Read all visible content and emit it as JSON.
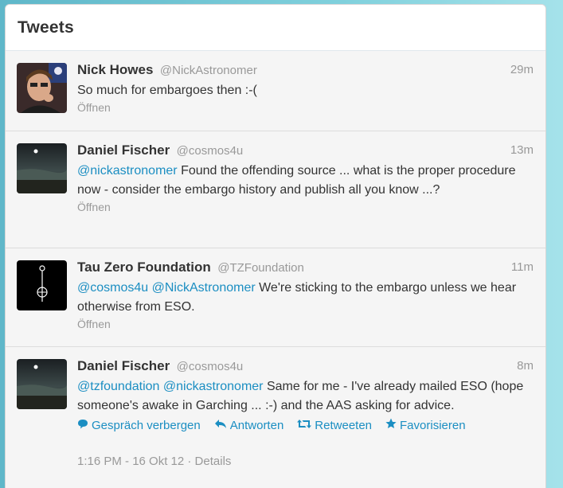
{
  "panel": {
    "title": "Tweets"
  },
  "tweets": [
    {
      "fullname": "Nick Howes",
      "username": "@NickAstronomer",
      "time": "29m",
      "text_parts": [
        {
          "text": "So much for embargoes then :-(",
          "mention": false
        }
      ],
      "open_label": "Öffnen"
    },
    {
      "fullname": "Daniel Fischer",
      "username": "@cosmos4u",
      "time": "13m",
      "text_parts": [
        {
          "text": "@nickastronomer",
          "mention": true
        },
        {
          "text": " Found the offending source ... what is the proper procedure now - consider the embargo history and publish all you know ...?",
          "mention": false
        }
      ],
      "open_label": "Öffnen"
    },
    {
      "fullname": "Tau Zero Foundation",
      "username": "@TZFoundation",
      "time": "11m",
      "text_parts": [
        {
          "text": "@cosmos4u",
          "mention": true
        },
        {
          "text": " ",
          "mention": false
        },
        {
          "text": "@NickAstronomer",
          "mention": true
        },
        {
          "text": " We're sticking to the embargo unless we hear otherwise from ESO.",
          "mention": false
        }
      ],
      "open_label": "Öffnen"
    },
    {
      "fullname": "Daniel Fischer",
      "username": "@cosmos4u",
      "time": "8m",
      "text_parts": [
        {
          "text": "@tzfoundation",
          "mention": true
        },
        {
          "text": " ",
          "mention": false
        },
        {
          "text": "@nickastronomer",
          "mention": true
        },
        {
          "text": " Same for me - I've already mailed ESO (hope someone's awake in Garching ... :-) and the AAS asking for advice.",
          "mention": false
        }
      ],
      "actions": {
        "hide_conversation": "Gespräch verbergen",
        "reply": "Antworten",
        "retweet": "Retweeten",
        "favorite": "Favorisieren"
      },
      "meta": "1:16 PM - 16 Okt 12 · Details"
    }
  ],
  "icons": {
    "conversation": "speech-bubble-icon",
    "reply": "reply-arrow-icon",
    "retweet": "retweet-icon",
    "favorite": "star-icon"
  },
  "colors": {
    "link": "#1b8ec2",
    "muted": "#999999",
    "text": "#333333"
  }
}
